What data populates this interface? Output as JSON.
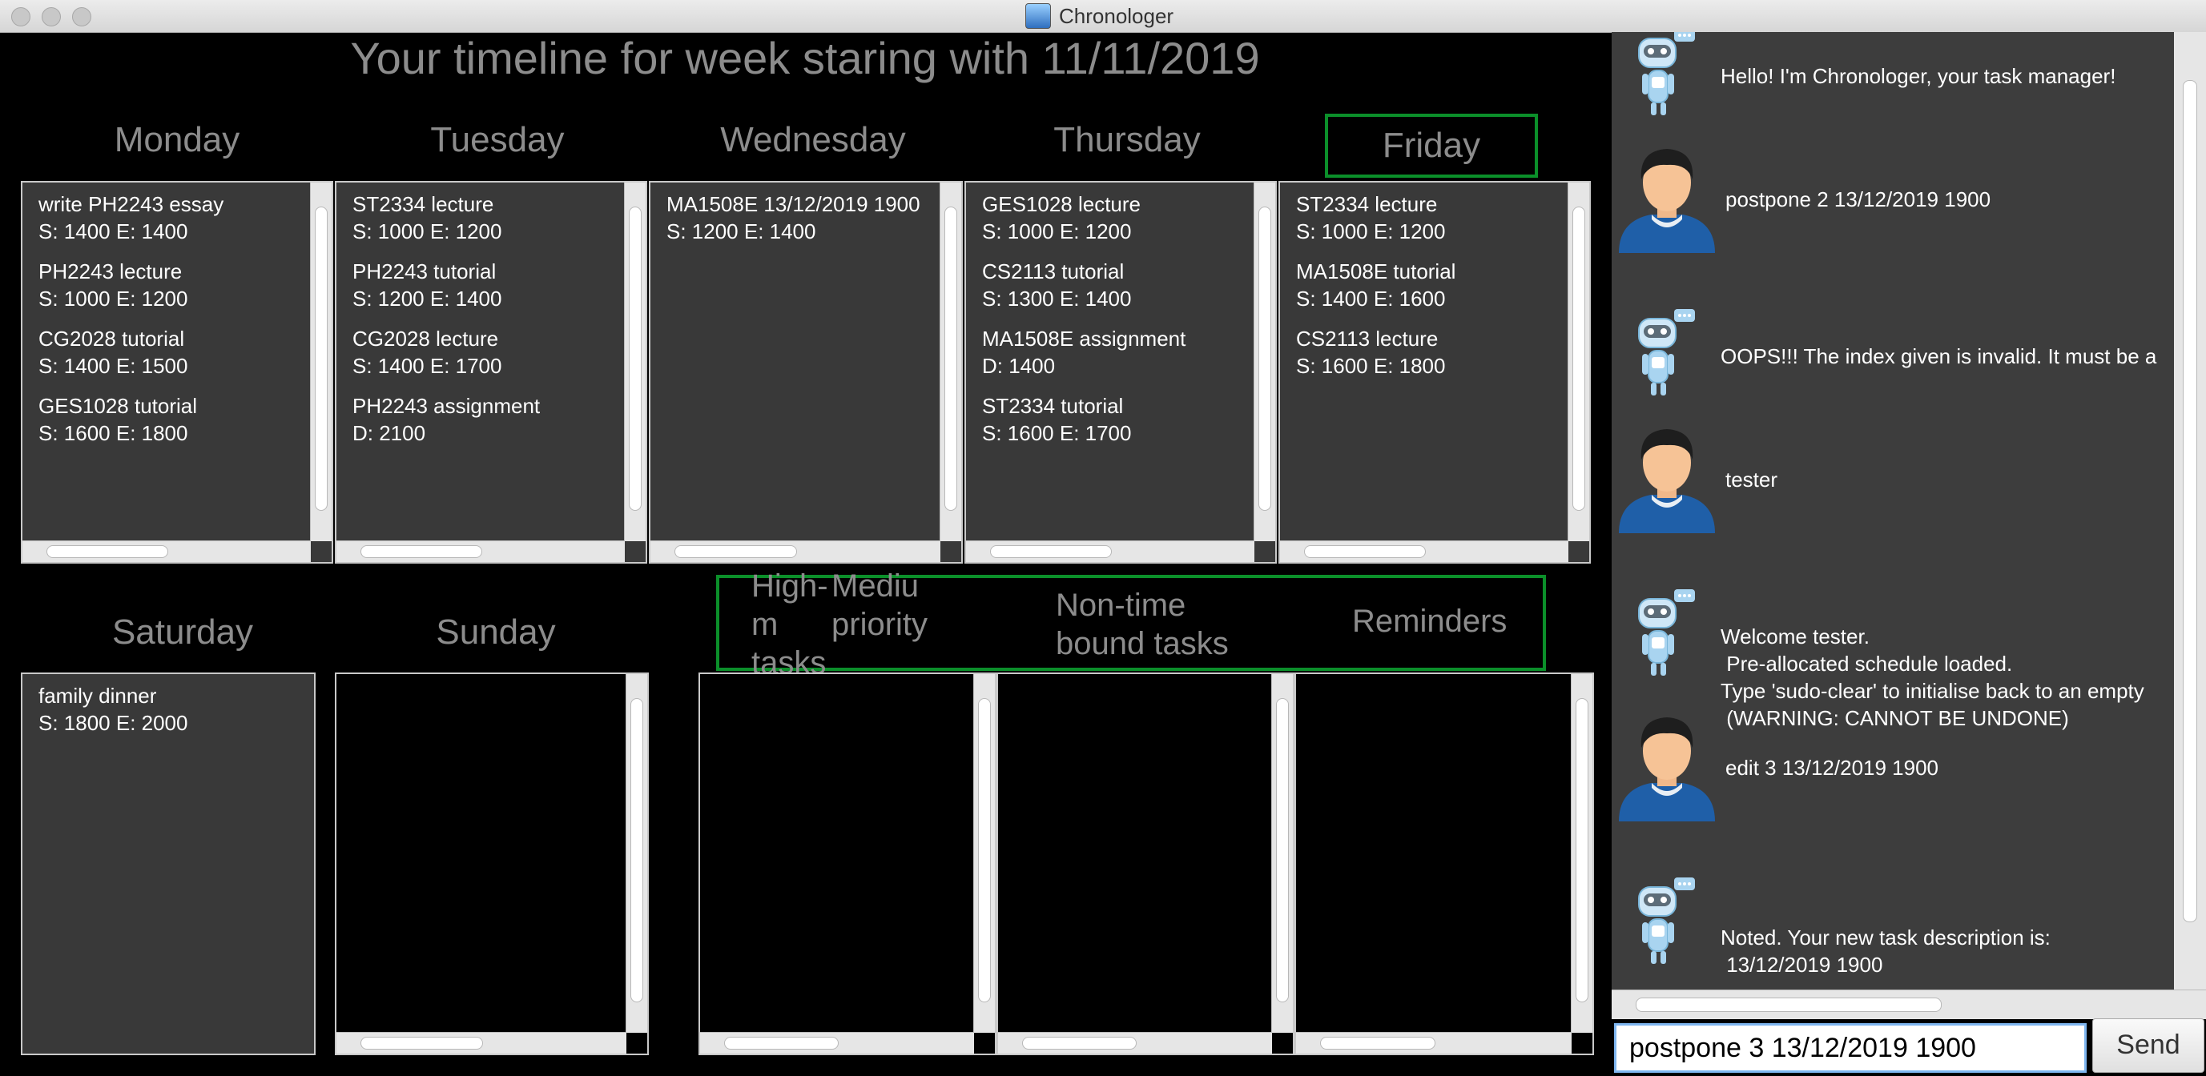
{
  "window": {
    "title": "Chronologer"
  },
  "timeline": {
    "heading": "Your timeline for week staring with 11/11/2019"
  },
  "days": {
    "monday": {
      "label": "Monday",
      "tasks": [
        {
          "name": "write PH2243 essay",
          "time": "S: 1400 E: 1400"
        },
        {
          "name": "PH2243 lecture",
          "time": "S: 1000 E: 1200"
        },
        {
          "name": "CG2028 tutorial",
          "time": "S: 1400 E: 1500"
        },
        {
          "name": "GES1028 tutorial",
          "time": "S: 1600 E: 1800"
        }
      ]
    },
    "tuesday": {
      "label": "Tuesday",
      "tasks": [
        {
          "name": "ST2334 lecture",
          "time": "S: 1000 E: 1200"
        },
        {
          "name": "PH2243 tutorial",
          "time": "S: 1200 E: 1400"
        },
        {
          "name": "CG2028 lecture",
          "time": "S: 1400 E: 1700"
        },
        {
          "name": "PH2243 assignment",
          "time": "D: 2100"
        }
      ]
    },
    "wednesday": {
      "label": "Wednesday",
      "tasks": [
        {
          "name": "MA1508E 13/12/2019 1900",
          "time": "S: 1200 E: 1400"
        }
      ]
    },
    "thursday": {
      "label": "Thursday",
      "tasks": [
        {
          "name": "GES1028 lecture",
          "time": "S: 1000 E: 1200"
        },
        {
          "name": "CS2113 tutorial",
          "time": "S: 1300 E: 1400"
        },
        {
          "name": "MA1508E assignment",
          "time": "D: 1400"
        },
        {
          "name": "ST2334 tutorial",
          "time": "S: 1600 E: 1700"
        }
      ]
    },
    "friday": {
      "label": "Friday",
      "tasks": [
        {
          "name": "ST2334 lecture",
          "time": "S: 1000 E: 1200"
        },
        {
          "name": "MA1508E tutorial",
          "time": "S: 1400 E: 1600"
        },
        {
          "name": "CS2113 lecture",
          "time": "S: 1600 E: 1800"
        }
      ]
    },
    "saturday": {
      "label": "Saturday",
      "tasks": [
        {
          "name": "family dinner",
          "time": "S: 1800 E: 2000"
        }
      ]
    },
    "sunday": {
      "label": "Sunday",
      "tasks": []
    }
  },
  "categories": {
    "high": "High-",
    "medium": "Mediu m priority",
    "high_line2": "m\ntasks",
    "medium_line2": "priority",
    "nontime": "Non-time\nbound tasks",
    "reminders": "Reminders"
  },
  "chat": [
    {
      "sender": "bot",
      "text": "Hello! I'm Chronologer, your task manager!"
    },
    {
      "sender": "user",
      "text": "postpone 2 13/12/2019 1900"
    },
    {
      "sender": "bot",
      "text": "OOPS!!! The index given is invalid. It must be a"
    },
    {
      "sender": "user",
      "text": "tester"
    },
    {
      "sender": "bot",
      "text": "Welcome tester.\n Pre-allocated schedule loaded.\nType 'sudo-clear' to initialise back to an empty\n (WARNING: CANNOT BE UNDONE)"
    },
    {
      "sender": "user",
      "text": "edit 3 13/12/2019 1900"
    },
    {
      "sender": "bot",
      "text": "Noted. Your new task description is:\n 13/12/2019 1900"
    }
  ],
  "input": {
    "value": "postpone 3 13/12/2019 1900",
    "send_label": "Send"
  }
}
